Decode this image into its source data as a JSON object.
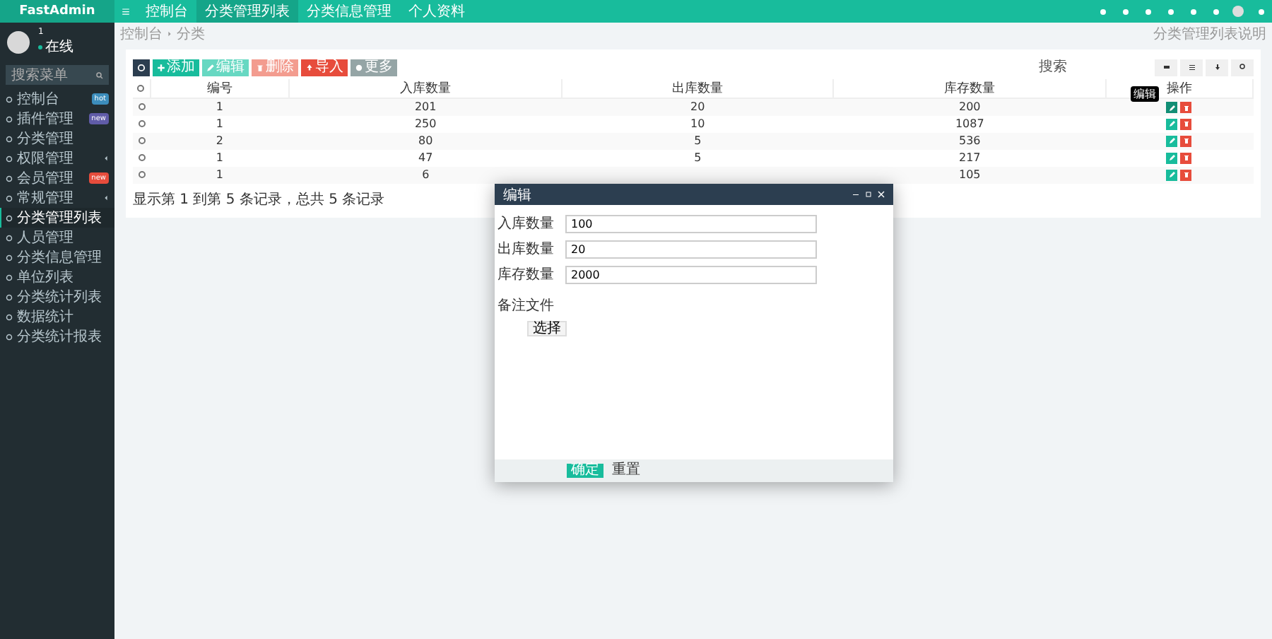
{
  "brand": "FastAdmin",
  "user": {
    "name": "1",
    "status": "在线"
  },
  "menu_search": {
    "placeholder": "搜索菜单"
  },
  "menu": [
    {
      "label": "控制台",
      "badge": "hot",
      "color": "#3c8dbc",
      "caret": false,
      "selected": false
    },
    {
      "label": "插件管理",
      "badge": "new",
      "color": "#605ca8",
      "caret": false,
      "selected": false
    },
    {
      "label": "分类管理",
      "caret": false,
      "selected": false
    },
    {
      "label": "权限管理",
      "caret": true,
      "selected": false
    },
    {
      "label": "会员管理",
      "badge": "new",
      "color": "#e74c3c",
      "caret": false,
      "selected": false
    },
    {
      "label": "常规管理",
      "caret": true,
      "selected": false
    },
    {
      "label": "分类管理列表",
      "caret": false,
      "selected": true
    },
    {
      "label": "人员管理",
      "caret": false,
      "selected": false
    },
    {
      "label": "分类信息管理",
      "caret": false,
      "selected": false
    },
    {
      "label": "单位列表",
      "caret": false,
      "selected": false
    },
    {
      "label": "分类统计列表",
      "caret": false,
      "selected": false
    },
    {
      "label": "数据统计",
      "caret": false,
      "selected": false
    },
    {
      "label": "分类统计报表",
      "caret": false,
      "selected": false
    }
  ],
  "tabs": [
    {
      "label": "控制台",
      "selected": false
    },
    {
      "label": "分类管理列表",
      "selected": true
    },
    {
      "label": "分类信息管理",
      "selected": false
    },
    {
      "label": "个人资料",
      "selected": false
    }
  ],
  "breadcrumb": [
    "控制台",
    "分类"
  ],
  "page_hint": "分类管理列表说明",
  "toolbar": [
    {
      "label": "添加",
      "kind": "add"
    },
    {
      "label": "编辑",
      "kind": "edit"
    },
    {
      "label": "删除",
      "kind": "delete"
    },
    {
      "label": "导入",
      "kind": "import"
    },
    {
      "label": "更多",
      "kind": "more"
    }
  ],
  "search": {
    "placeholder": "搜索"
  },
  "table": {
    "columns": [
      "编号",
      "入库数量",
      "出库数量",
      "库存数量",
      "操作"
    ],
    "all_checked": false,
    "rows": [
      {
        "cells": [
          "1",
          "201",
          "20",
          "200"
        ],
        "checked": false
      },
      {
        "cells": [
          "1",
          "250",
          "10",
          "1087"
        ],
        "checked": false
      },
      {
        "cells": [
          "2",
          "80",
          "5",
          "536"
        ],
        "checked": false
      },
      {
        "cells": [
          "1",
          "47",
          "5",
          "217"
        ],
        "checked": false
      },
      {
        "cells": [
          "1",
          "6",
          null,
          "105"
        ],
        "checked": false
      }
    ]
  },
  "tooltip": "编辑",
  "footer": "显示第 1 到第 5 条记录，总共 5 条记录",
  "dialog": {
    "title": "编辑",
    "fields": [
      {
        "label": "入库数量",
        "value": "100"
      },
      {
        "label": "出库数量",
        "value": "20"
      },
      {
        "label": "库存数量",
        "value": "2000"
      }
    ],
    "file_label": "备注文件",
    "file_button": "选择",
    "buttons": [
      "确定",
      "重置"
    ]
  }
}
